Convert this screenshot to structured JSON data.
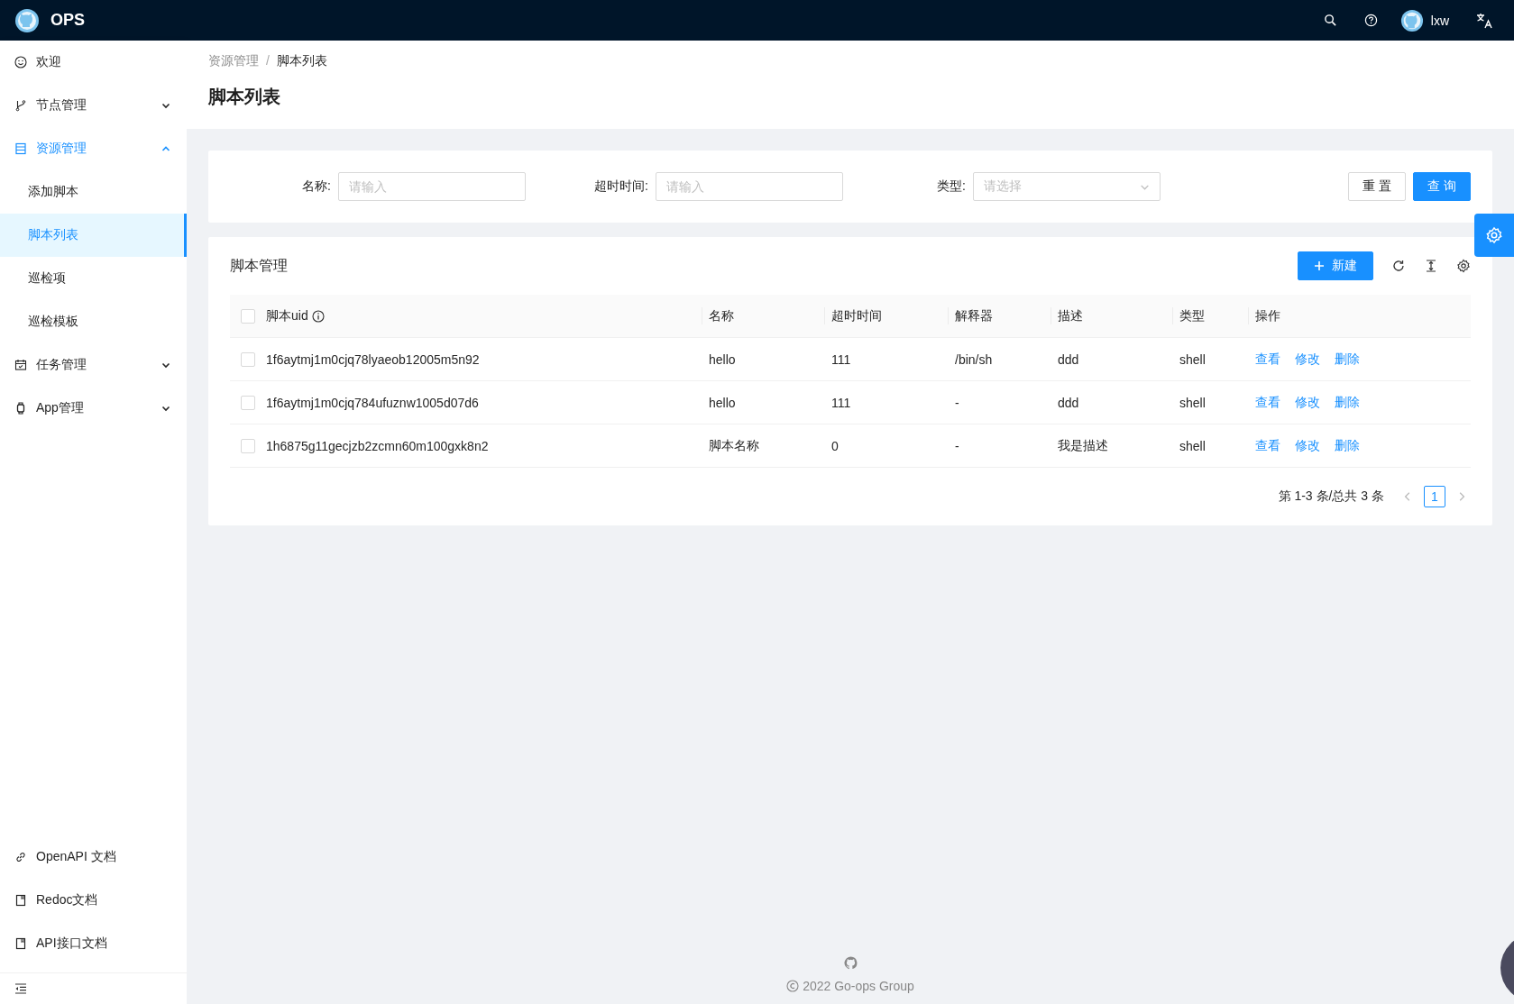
{
  "header": {
    "logo_text": "OPS",
    "user": "lxw"
  },
  "sidebar": {
    "items": [
      {
        "kind": "item",
        "label": "欢迎",
        "selected": false
      },
      {
        "kind": "group",
        "label": "节点管理",
        "expanded": false
      },
      {
        "kind": "group",
        "label": "资源管理",
        "expanded": true,
        "children": [
          {
            "label": "添加脚本",
            "selected": false
          },
          {
            "label": "脚本列表",
            "selected": true
          },
          {
            "label": "巡检项",
            "selected": false
          },
          {
            "label": "巡检模板",
            "selected": false
          }
        ]
      },
      {
        "kind": "group",
        "label": "任务管理",
        "expanded": false
      },
      {
        "kind": "group",
        "label": "App管理",
        "expanded": false
      }
    ],
    "links": [
      "OpenAPI 文档",
      "Redoc文档",
      "API接口文档"
    ]
  },
  "breadcrumb": [
    "资源管理",
    "脚本列表"
  ],
  "breadcrumb_separator": "/",
  "page_title": "脚本列表",
  "filters": [
    {
      "kind": "input",
      "label": "名称:",
      "placeholder": "请输入"
    },
    {
      "kind": "input",
      "label": "超时时间:",
      "placeholder": "请输入"
    },
    {
      "kind": "select",
      "label": "类型:",
      "placeholder": "请选择"
    }
  ],
  "filter_buttons": [
    {
      "kind": "default",
      "label": "重 置"
    },
    {
      "kind": "primary",
      "label": "查 询"
    }
  ],
  "table": {
    "title": "脚本管理",
    "new_button": "新建",
    "select_all_checked": false,
    "columns": [
      "脚本uid",
      "名称",
      "超时时间",
      "解释器",
      "描述",
      "类型",
      "操作"
    ],
    "rows": [
      {
        "checked": false,
        "cells": [
          "1f6aytmj1m0cjq78lyaeob12005m5n92",
          "hello",
          "111",
          "/bin/sh",
          "ddd",
          "shell"
        ],
        "actions": [
          "查看",
          "修改",
          "删除"
        ]
      },
      {
        "checked": false,
        "cells": [
          "1f6aytmj1m0cjq784ufuznw1005d07d6",
          "hello",
          "111",
          "-",
          "ddd",
          "shell"
        ],
        "actions": [
          "查看",
          "修改",
          "删除"
        ]
      },
      {
        "checked": false,
        "cells": [
          "1h6875g11gecjzb2zcmn60m100gxk8n2",
          "脚本名称",
          "0",
          "-",
          "我是描述",
          "shell"
        ],
        "actions": [
          "查看",
          "修改",
          "删除"
        ]
      }
    ],
    "pagination": {
      "summary": "第 1-3 条/总共 3 条",
      "pages": [
        {
          "label": "1",
          "selected": true
        }
      ]
    }
  },
  "footer": {
    "copyright": "2022 Go-ops Group"
  }
}
